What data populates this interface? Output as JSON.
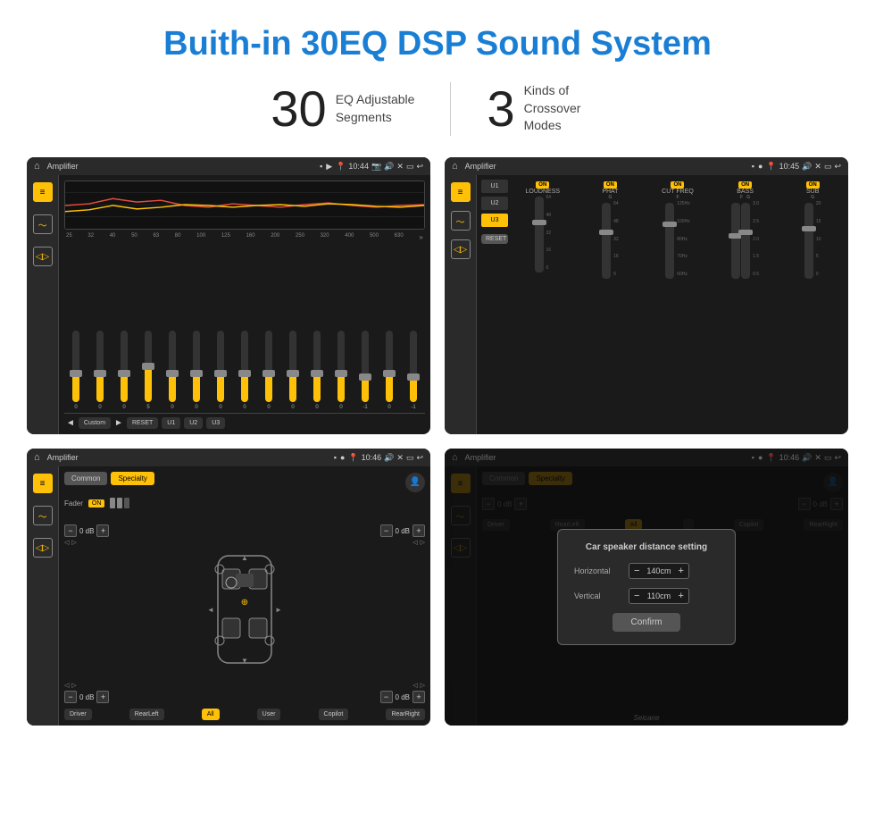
{
  "header": {
    "title": "Buith-in 30EQ DSP Sound System"
  },
  "stats": [
    {
      "number": "30",
      "label": "EQ Adjustable\nSegments"
    },
    {
      "number": "3",
      "label": "Kinds of\nCrossover Modes"
    }
  ],
  "screens": [
    {
      "id": "eq-amplifier",
      "statusBar": {
        "title": "Amplifier",
        "time": "10:44"
      },
      "type": "equalizer"
    },
    {
      "id": "crossover-amplifier",
      "statusBar": {
        "title": "Amplifier",
        "time": "10:45"
      },
      "type": "crossover"
    },
    {
      "id": "specialty-amplifier",
      "statusBar": {
        "title": "Amplifier",
        "time": "10:46"
      },
      "type": "specialty"
    },
    {
      "id": "distance-amplifier",
      "statusBar": {
        "title": "Amplifier",
        "time": "10:46"
      },
      "type": "distance-dialog"
    }
  ],
  "eq": {
    "frequencies": [
      "25",
      "32",
      "40",
      "50",
      "63",
      "80",
      "100",
      "125",
      "160",
      "200",
      "250",
      "320",
      "400",
      "500",
      "630"
    ],
    "sliderHeights": [
      50,
      45,
      55,
      60,
      50,
      45,
      50,
      55,
      50,
      45,
      50,
      55,
      48,
      42,
      48
    ],
    "values": [
      "0",
      "0",
      "0",
      "0",
      "5",
      "0",
      "0",
      "0",
      "0",
      "0",
      "0",
      "0",
      "0",
      "-1",
      "0",
      "-1"
    ],
    "bottomBtns": [
      "RESET",
      "U1",
      "U2",
      "U3"
    ],
    "currentPreset": "Custom"
  },
  "crossover": {
    "presets": [
      "U1",
      "U2",
      "U3"
    ],
    "activePreset": "U3",
    "bands": [
      {
        "name": "LOUDNESS",
        "on": true
      },
      {
        "name": "PHAT",
        "on": true
      },
      {
        "name": "CUT FREQ",
        "on": true
      },
      {
        "name": "BASS",
        "on": true
      },
      {
        "name": "SUB",
        "on": true
      }
    ]
  },
  "specialty": {
    "modes": [
      "Common",
      "Specialty"
    ],
    "activeMode": "Specialty",
    "fader": "ON",
    "volumes": [
      {
        "label": "0 dB",
        "pos": "top-left"
      },
      {
        "label": "0 dB",
        "pos": "top-right"
      },
      {
        "label": "0 dB",
        "pos": "bottom-left"
      },
      {
        "label": "0 dB",
        "pos": "bottom-right"
      }
    ],
    "bottomBtns": [
      "Driver",
      "RearLeft",
      "All",
      "User",
      "Copilot",
      "RearRight"
    ]
  },
  "distanceDialog": {
    "title": "Car speaker distance setting",
    "horizontal": "140cm",
    "vertical": "110cm",
    "confirmLabel": "Confirm",
    "bottomBtns": [
      "Driver",
      "RearLeft",
      "All",
      "User",
      "Copilot",
      "RearRight"
    ]
  },
  "watermark": "Seicane"
}
